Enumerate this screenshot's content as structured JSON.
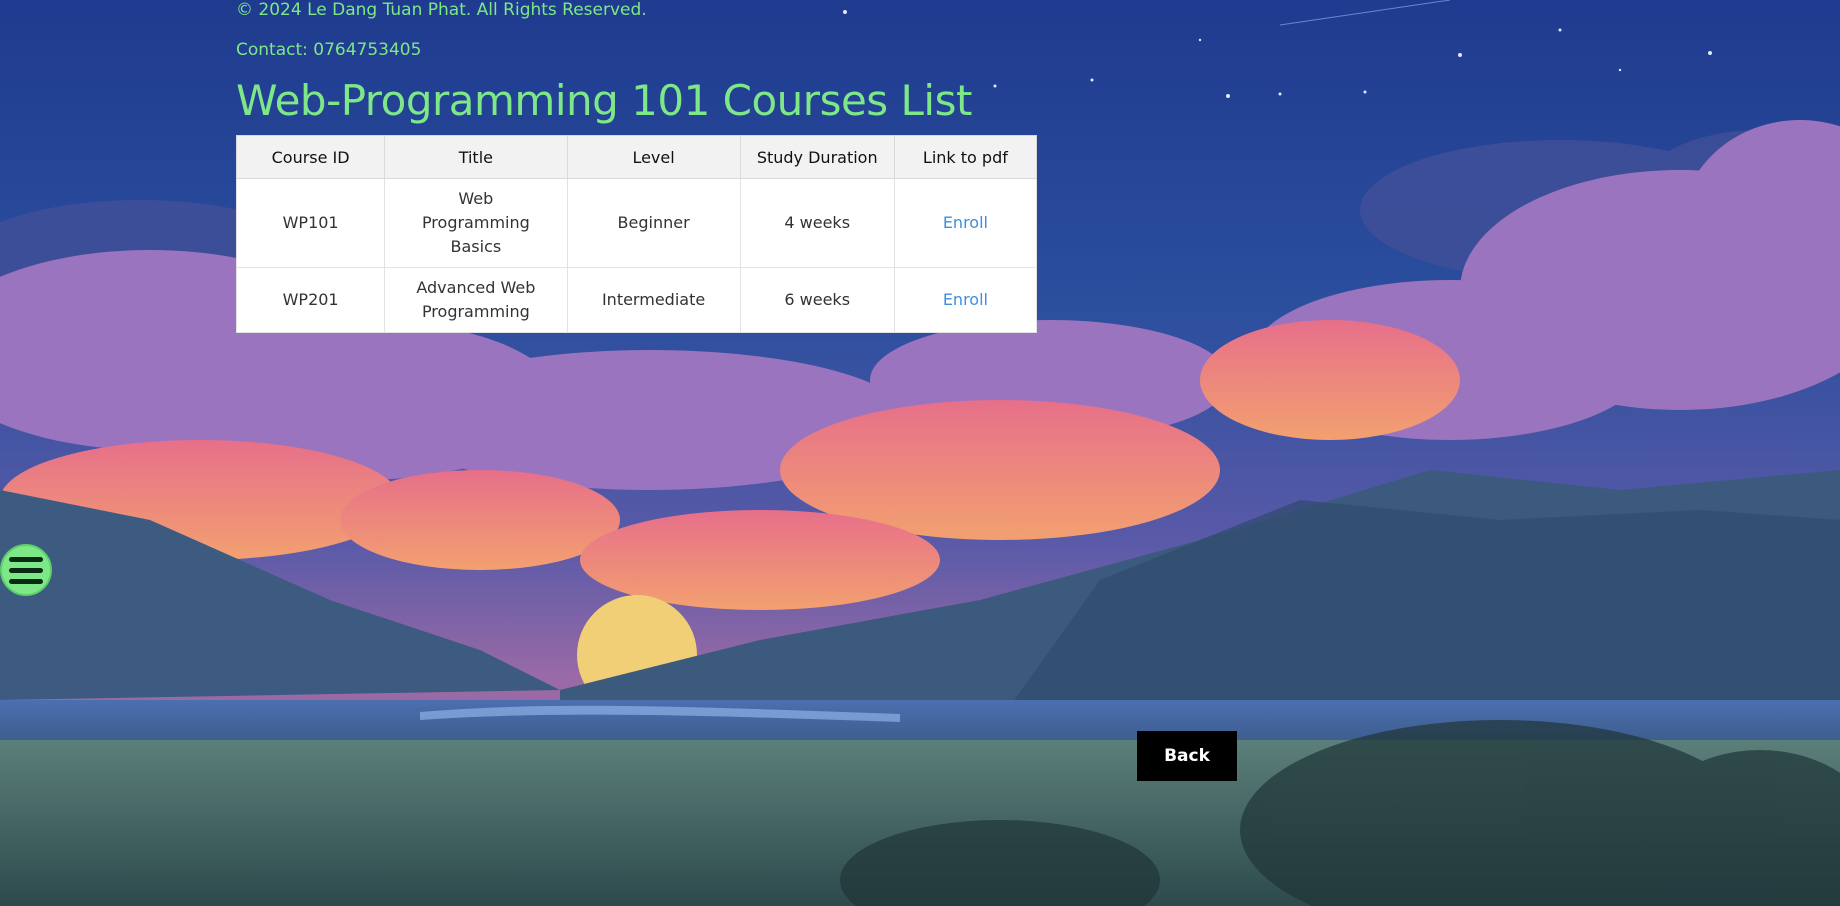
{
  "footer": {
    "copyright": "© 2024 Le Dang Tuan Phat. All Rights Reserved.",
    "contact": "Contact: 0764753405"
  },
  "main": {
    "title": "Web-Programming 101 Courses List",
    "table": {
      "headers": [
        "Course ID",
        "Title",
        "Level",
        "Study Duration",
        "Link to pdf"
      ],
      "rows": [
        {
          "course_id": "WP101",
          "title": "Web Programming Basics",
          "level": "Beginner",
          "duration": "4 weeks",
          "link": "Enroll"
        },
        {
          "course_id": "WP201",
          "title": "Advanced Web Programming",
          "level": "Intermediate",
          "duration": "6 weeks",
          "link": "Enroll"
        }
      ]
    },
    "back_label": "Back"
  },
  "colors": {
    "accent": "#7ee787",
    "link": "#3d8fe0",
    "button_bg": "#000000"
  },
  "icons": {
    "menu": "hamburger-menu-icon"
  }
}
